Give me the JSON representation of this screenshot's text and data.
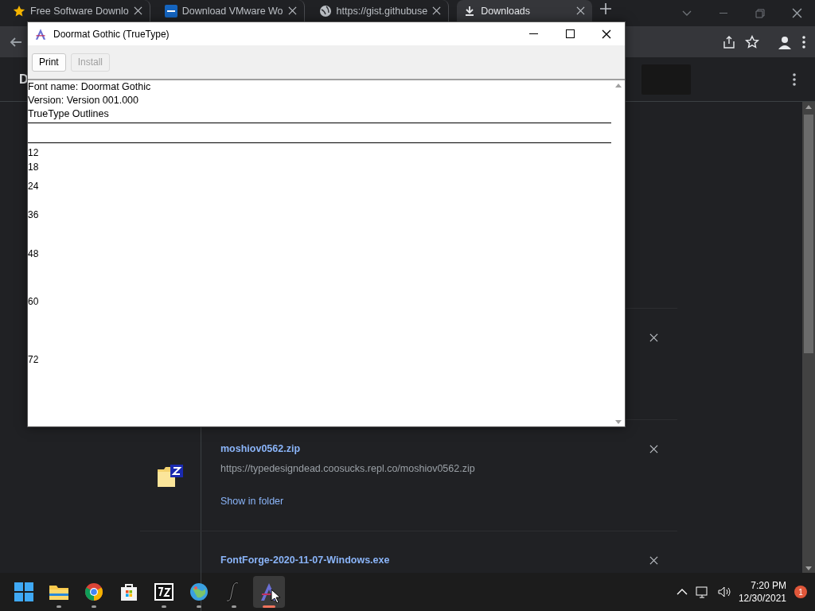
{
  "browser": {
    "tabs": [
      {
        "title": "Free Software Downlo",
        "selected": false
      },
      {
        "title": "Download VMware Wo",
        "selected": false
      },
      {
        "title": "https://gist.githubuse",
        "selected": false
      },
      {
        "title": "Downloads",
        "selected": true
      }
    ],
    "page_title": "D",
    "downloads": [
      {
        "name": "moshiov0562.zip",
        "url": "https://typedesigndead.coosucks.repl.co/moshiov0562.zip",
        "action": "Show in folder"
      },
      {
        "name": "FontForge-2020-11-07-Windows.exe"
      }
    ]
  },
  "font_window": {
    "title": "Doormat Gothic (TrueType)",
    "buttons": [
      {
        "label": "Print",
        "disabled": false
      },
      {
        "label": "Install",
        "disabled": true
      }
    ],
    "info": [
      "Font name: Doormat Gothic",
      "Version: Version 001.000",
      "TrueType Outlines"
    ],
    "sizes": [
      "12",
      "18",
      "24",
      "36",
      "48",
      "60",
      "72"
    ]
  },
  "taskbar": {
    "apps": [
      {
        "running": false,
        "selected": false
      },
      {
        "running": true,
        "selected": false
      },
      {
        "running": true,
        "selected": false
      },
      {
        "running": false,
        "selected": false
      },
      {
        "running": true,
        "selected": false
      },
      {
        "running": true,
        "selected": false
      },
      {
        "running": true,
        "selected": false
      },
      {
        "running": true,
        "selected": true
      }
    ],
    "time": "7:20 PM",
    "date": "12/30/2021",
    "notifications": "1"
  }
}
